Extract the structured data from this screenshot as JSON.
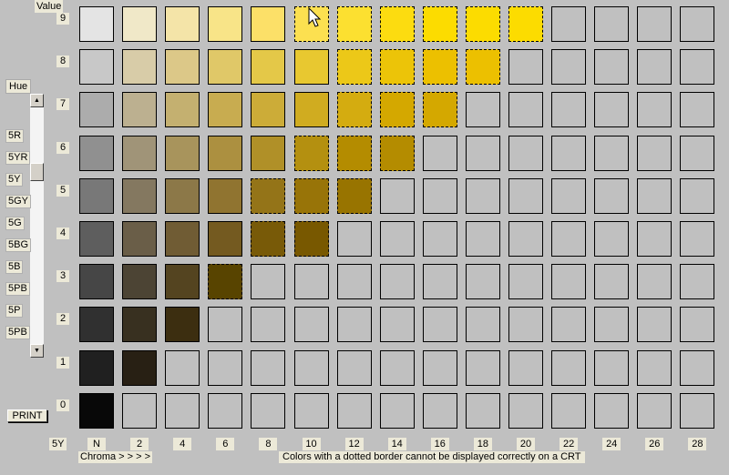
{
  "value_title": "Value",
  "hue_title": "Hue",
  "hue_items": [
    "5R",
    "5YR",
    "5Y",
    "5GY",
    "5G",
    "5BG",
    "5B",
    "5PB",
    "5P",
    "5PB"
  ],
  "current_hue": "5Y",
  "chroma_title": "Chroma > > > >",
  "note": "Colors with a dotted border cannot be displayed correctly on a CRT",
  "print_label": "PRINT",
  "column_labels": [
    "N",
    "2",
    "4",
    "6",
    "8",
    "10",
    "12",
    "14",
    "16",
    "18",
    "20",
    "22",
    "24",
    "26",
    "28"
  ],
  "rows": [
    {
      "value": "9",
      "cells": [
        {
          "color": "#e4e4e4",
          "dotted": false
        },
        {
          "color": "#f0e8c8",
          "dotted": false
        },
        {
          "color": "#f4e4a8",
          "dotted": false
        },
        {
          "color": "#f8e488",
          "dotted": false
        },
        {
          "color": "#fce068",
          "dotted": false
        },
        {
          "color": "#fce050",
          "dotted": true
        },
        {
          "color": "#fce030",
          "dotted": true
        },
        {
          "color": "#fcdc10",
          "dotted": true
        },
        {
          "color": "#fcdc00",
          "dotted": true
        },
        {
          "color": "#fcdc00",
          "dotted": true
        },
        {
          "color": "#fcdc00",
          "dotted": true
        },
        {
          "color": "#c0c0c0",
          "dotted": false
        },
        {
          "color": "#c0c0c0",
          "dotted": false
        },
        {
          "color": "#c0c0c0",
          "dotted": false
        },
        {
          "color": "#c0c0c0",
          "dotted": false
        }
      ]
    },
    {
      "value": "8",
      "cells": [
        {
          "color": "#c8c8c8",
          "dotted": false
        },
        {
          "color": "#d8cca8",
          "dotted": false
        },
        {
          "color": "#dcc888",
          "dotted": false
        },
        {
          "color": "#e0c868",
          "dotted": false
        },
        {
          "color": "#e4c848",
          "dotted": false
        },
        {
          "color": "#e8c830",
          "dotted": false
        },
        {
          "color": "#ecc818",
          "dotted": true
        },
        {
          "color": "#ecc408",
          "dotted": true
        },
        {
          "color": "#ecc000",
          "dotted": true
        },
        {
          "color": "#ecc000",
          "dotted": true
        },
        {
          "color": "#c0c0c0",
          "dotted": false
        },
        {
          "color": "#c0c0c0",
          "dotted": false
        },
        {
          "color": "#c0c0c0",
          "dotted": false
        },
        {
          "color": "#c0c0c0",
          "dotted": false
        },
        {
          "color": "#c0c0c0",
          "dotted": false
        }
      ]
    },
    {
      "value": "7",
      "cells": [
        {
          "color": "#acacac",
          "dotted": false
        },
        {
          "color": "#bcb090",
          "dotted": false
        },
        {
          "color": "#c4b070",
          "dotted": false
        },
        {
          "color": "#c8ac50",
          "dotted": false
        },
        {
          "color": "#ccac38",
          "dotted": false
        },
        {
          "color": "#d0ac20",
          "dotted": false
        },
        {
          "color": "#d4ac10",
          "dotted": true
        },
        {
          "color": "#d4a800",
          "dotted": true
        },
        {
          "color": "#d4a800",
          "dotted": true
        },
        {
          "color": "#c0c0c0",
          "dotted": false
        },
        {
          "color": "#c0c0c0",
          "dotted": false
        },
        {
          "color": "#c0c0c0",
          "dotted": false
        },
        {
          "color": "#c0c0c0",
          "dotted": false
        },
        {
          "color": "#c0c0c0",
          "dotted": false
        },
        {
          "color": "#c0c0c0",
          "dotted": false
        }
      ]
    },
    {
      "value": "6",
      "cells": [
        {
          "color": "#909090",
          "dotted": false
        },
        {
          "color": "#a09478",
          "dotted": false
        },
        {
          "color": "#a8945c",
          "dotted": false
        },
        {
          "color": "#ac9040",
          "dotted": false
        },
        {
          "color": "#b09028",
          "dotted": false
        },
        {
          "color": "#b49010",
          "dotted": true
        },
        {
          "color": "#b48c00",
          "dotted": true
        },
        {
          "color": "#b48c00",
          "dotted": true
        },
        {
          "color": "#c0c0c0",
          "dotted": false
        },
        {
          "color": "#c0c0c0",
          "dotted": false
        },
        {
          "color": "#c0c0c0",
          "dotted": false
        },
        {
          "color": "#c0c0c0",
          "dotted": false
        },
        {
          "color": "#c0c0c0",
          "dotted": false
        },
        {
          "color": "#c0c0c0",
          "dotted": false
        },
        {
          "color": "#c0c0c0",
          "dotted": false
        }
      ]
    },
    {
      "value": "5",
      "cells": [
        {
          "color": "#787878",
          "dotted": false
        },
        {
          "color": "#847860",
          "dotted": false
        },
        {
          "color": "#8c7848",
          "dotted": false
        },
        {
          "color": "#907430",
          "dotted": false
        },
        {
          "color": "#947418",
          "dotted": true
        },
        {
          "color": "#987408",
          "dotted": true
        },
        {
          "color": "#987400",
          "dotted": true
        },
        {
          "color": "#c0c0c0",
          "dotted": false
        },
        {
          "color": "#c0c0c0",
          "dotted": false
        },
        {
          "color": "#c0c0c0",
          "dotted": false
        },
        {
          "color": "#c0c0c0",
          "dotted": false
        },
        {
          "color": "#c0c0c0",
          "dotted": false
        },
        {
          "color": "#c0c0c0",
          "dotted": false
        },
        {
          "color": "#c0c0c0",
          "dotted": false
        },
        {
          "color": "#c0c0c0",
          "dotted": false
        }
      ]
    },
    {
      "value": "4",
      "cells": [
        {
          "color": "#5e5e5e",
          "dotted": false
        },
        {
          "color": "#6a5e48",
          "dotted": false
        },
        {
          "color": "#705c34",
          "dotted": false
        },
        {
          "color": "#745a20",
          "dotted": false
        },
        {
          "color": "#785a08",
          "dotted": true
        },
        {
          "color": "#785800",
          "dotted": true
        },
        {
          "color": "#c0c0c0",
          "dotted": false
        },
        {
          "color": "#c0c0c0",
          "dotted": false
        },
        {
          "color": "#c0c0c0",
          "dotted": false
        },
        {
          "color": "#c0c0c0",
          "dotted": false
        },
        {
          "color": "#c0c0c0",
          "dotted": false
        },
        {
          "color": "#c0c0c0",
          "dotted": false
        },
        {
          "color": "#c0c0c0",
          "dotted": false
        },
        {
          "color": "#c0c0c0",
          "dotted": false
        },
        {
          "color": "#c0c0c0",
          "dotted": false
        }
      ]
    },
    {
      "value": "3",
      "cells": [
        {
          "color": "#464646",
          "dotted": false
        },
        {
          "color": "#4c4434",
          "dotted": false
        },
        {
          "color": "#544420",
          "dotted": false
        },
        {
          "color": "#584400",
          "dotted": true
        },
        {
          "color": "#c0c0c0",
          "dotted": false
        },
        {
          "color": "#c0c0c0",
          "dotted": false
        },
        {
          "color": "#c0c0c0",
          "dotted": false
        },
        {
          "color": "#c0c0c0",
          "dotted": false
        },
        {
          "color": "#c0c0c0",
          "dotted": false
        },
        {
          "color": "#c0c0c0",
          "dotted": false
        },
        {
          "color": "#c0c0c0",
          "dotted": false
        },
        {
          "color": "#c0c0c0",
          "dotted": false
        },
        {
          "color": "#c0c0c0",
          "dotted": false
        },
        {
          "color": "#c0c0c0",
          "dotted": false
        },
        {
          "color": "#c0c0c0",
          "dotted": false
        }
      ]
    },
    {
      "value": "2",
      "cells": [
        {
          "color": "#303030",
          "dotted": false
        },
        {
          "color": "#383020",
          "dotted": false
        },
        {
          "color": "#3c2e10",
          "dotted": false
        },
        {
          "color": "#c0c0c0",
          "dotted": false
        },
        {
          "color": "#c0c0c0",
          "dotted": false
        },
        {
          "color": "#c0c0c0",
          "dotted": false
        },
        {
          "color": "#c0c0c0",
          "dotted": false
        },
        {
          "color": "#c0c0c0",
          "dotted": false
        },
        {
          "color": "#c0c0c0",
          "dotted": false
        },
        {
          "color": "#c0c0c0",
          "dotted": false
        },
        {
          "color": "#c0c0c0",
          "dotted": false
        },
        {
          "color": "#c0c0c0",
          "dotted": false
        },
        {
          "color": "#c0c0c0",
          "dotted": false
        },
        {
          "color": "#c0c0c0",
          "dotted": false
        },
        {
          "color": "#c0c0c0",
          "dotted": false
        }
      ]
    },
    {
      "value": "1",
      "cells": [
        {
          "color": "#202020",
          "dotted": false
        },
        {
          "color": "#282014",
          "dotted": false
        },
        {
          "color": "#c0c0c0",
          "dotted": false
        },
        {
          "color": "#c0c0c0",
          "dotted": false
        },
        {
          "color": "#c0c0c0",
          "dotted": false
        },
        {
          "color": "#c0c0c0",
          "dotted": false
        },
        {
          "color": "#c0c0c0",
          "dotted": false
        },
        {
          "color": "#c0c0c0",
          "dotted": false
        },
        {
          "color": "#c0c0c0",
          "dotted": false
        },
        {
          "color": "#c0c0c0",
          "dotted": false
        },
        {
          "color": "#c0c0c0",
          "dotted": false
        },
        {
          "color": "#c0c0c0",
          "dotted": false
        },
        {
          "color": "#c0c0c0",
          "dotted": false
        },
        {
          "color": "#c0c0c0",
          "dotted": false
        },
        {
          "color": "#c0c0c0",
          "dotted": false
        }
      ]
    },
    {
      "value": "0",
      "cells": [
        {
          "color": "#080808",
          "dotted": false
        },
        {
          "color": "#c0c0c0",
          "dotted": false
        },
        {
          "color": "#c0c0c0",
          "dotted": false
        },
        {
          "color": "#c0c0c0",
          "dotted": false
        },
        {
          "color": "#c0c0c0",
          "dotted": false
        },
        {
          "color": "#c0c0c0",
          "dotted": false
        },
        {
          "color": "#c0c0c0",
          "dotted": false
        },
        {
          "color": "#c0c0c0",
          "dotted": false
        },
        {
          "color": "#c0c0c0",
          "dotted": false
        },
        {
          "color": "#c0c0c0",
          "dotted": false
        },
        {
          "color": "#c0c0c0",
          "dotted": false
        },
        {
          "color": "#c0c0c0",
          "dotted": false
        },
        {
          "color": "#c0c0c0",
          "dotted": false
        },
        {
          "color": "#c0c0c0",
          "dotted": false
        },
        {
          "color": "#c0c0c0",
          "dotted": false
        }
      ]
    }
  ]
}
